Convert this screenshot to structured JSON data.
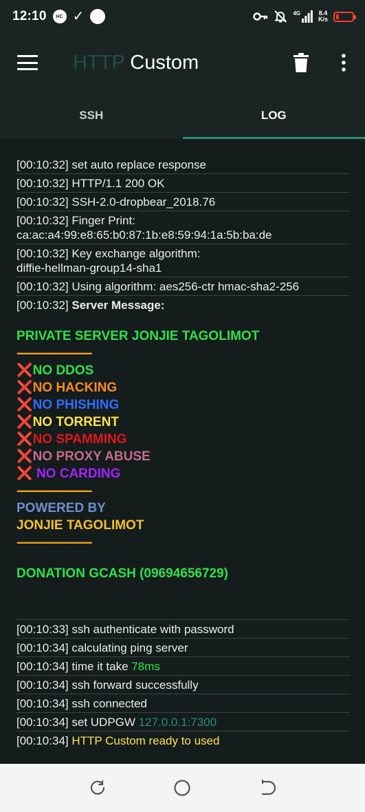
{
  "status_bar": {
    "time": "12:10",
    "hc_badge": "HC",
    "net_type": "4G",
    "net_speed_value": "8.4",
    "net_speed_unit": "K/s",
    "battery_level": 0.1,
    "battery_color": "#ff3b30"
  },
  "app_bar": {
    "title_part1": "HTTP",
    "title_part2": "Custom",
    "menu_icon": "hamburger-icon",
    "delete_icon": "trash-icon",
    "more_icon": "more-vert-icon"
  },
  "tabs": [
    {
      "label": "SSH",
      "active": false
    },
    {
      "label": "LOG",
      "active": true
    }
  ],
  "accent_color": "#2e8f78",
  "log": {
    "lines_top": [
      {
        "time": "[00:10:32]",
        "text": "set auto replace response"
      },
      {
        "time": "[00:10:32]",
        "text": "HTTP/1.1 200 OK"
      },
      {
        "time": "[00:10:32]",
        "text": "SSH-2.0-dropbear_2018.76"
      },
      {
        "time": "[00:10:32]",
        "text": "Finger Print:",
        "text2": "ca:ac:a4:99:e8:65:b0:87:1b:e8:59:94:1a:5b:ba:de"
      },
      {
        "time": "[00:10:32]",
        "text": "Key exchange algorithm:",
        "text2": "diffie-hellman-group14-sha1"
      },
      {
        "time": "[00:10:32]",
        "text": "Using algorithm: aes256-ctr hmac-sha2-256"
      },
      {
        "time": "[00:10:32]",
        "text": "Server Message:"
      }
    ],
    "server_message": {
      "title": "PRIVATE SERVER JONJIE TAGOLIMOT",
      "divider": "-----------------------------",
      "x_mark": "❌",
      "rules": [
        {
          "text": "NO DDOS",
          "color": "#2ee04a"
        },
        {
          "text": "NO HACKING",
          "color": "#ff8a1f"
        },
        {
          "text": "NO PHISHING",
          "color": "#2f6cff"
        },
        {
          "text": "NO TORRENT",
          "color": "#ffe24a"
        },
        {
          "text": "NO SPAMMING",
          "color": "#e0161d"
        },
        {
          "text": "NO PROXY ABUSE",
          "color": "#c56b8c"
        },
        {
          "text": " NO CARDING",
          "color": "#a322ff"
        }
      ],
      "powered_by": "POWERED BY",
      "owner": "JONJIE TAGOLIMOT",
      "donation": "DONATION GCASH (09694656729)"
    },
    "lines_bottom": [
      {
        "time": "[00:10:33]",
        "text": "ssh authenticate with password"
      },
      {
        "time": "[00:10:34]",
        "text": "calculating ping server"
      },
      {
        "time": "[00:10:34]",
        "text": "time it take ",
        "value": "78ms"
      },
      {
        "time": "[00:10:34]",
        "text": "ssh forward successfully"
      },
      {
        "time": "[00:10:34]",
        "text": "ssh connected"
      },
      {
        "time": "[00:10:34]",
        "text": "set UDPGW ",
        "value": "127.0.0.1:7300"
      },
      {
        "time": "[00:10:34]",
        "value": "HTTP Custom ready to used"
      }
    ]
  },
  "nav_bar": {
    "recents_icon": "recents-icon",
    "home_icon": "home-icon",
    "back_icon": "back-icon"
  }
}
